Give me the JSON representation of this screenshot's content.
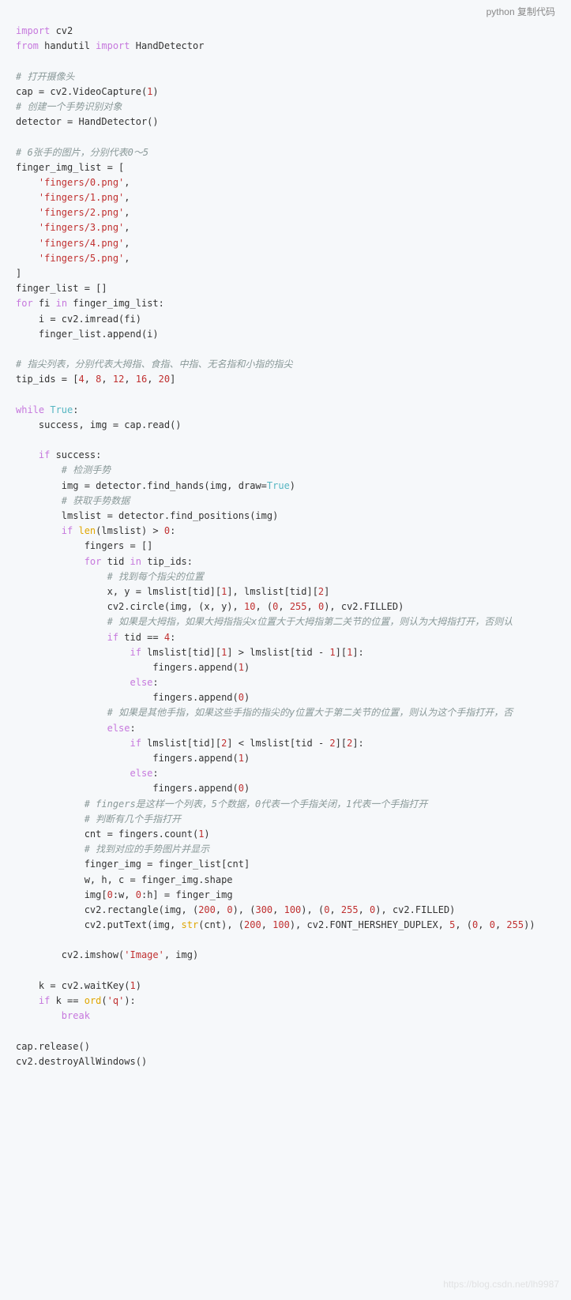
{
  "header": {
    "lang": "python",
    "copy": "复制代码"
  },
  "watermark": "https://blog.csdn.net/lh9987",
  "code_lines": [
    [
      {
        "t": "import",
        "c": "kw"
      },
      {
        "t": " cv2",
        "c": "id"
      }
    ],
    [
      {
        "t": "from",
        "c": "kw"
      },
      {
        "t": " handutil ",
        "c": "id"
      },
      {
        "t": "import",
        "c": "kw"
      },
      {
        "t": " HandDetector",
        "c": "id"
      }
    ],
    [],
    [
      {
        "t": "# 打开摄像头",
        "c": "com"
      }
    ],
    [
      {
        "t": "cap = cv2.VideoCapture(",
        "c": "id"
      },
      {
        "t": "1",
        "c": "num"
      },
      {
        "t": ")",
        "c": "id"
      }
    ],
    [
      {
        "t": "# 创建一个手势识别对象",
        "c": "com"
      }
    ],
    [
      {
        "t": "detector = HandDetector()",
        "c": "id"
      }
    ],
    [],
    [
      {
        "t": "# 6张手的图片，分别代表0～5",
        "c": "com"
      }
    ],
    [
      {
        "t": "finger_img_list = [",
        "c": "id"
      }
    ],
    [
      {
        "t": "    ",
        "c": "id"
      },
      {
        "t": "'fingers/0.png'",
        "c": "str"
      },
      {
        "t": ",",
        "c": "id"
      }
    ],
    [
      {
        "t": "    ",
        "c": "id"
      },
      {
        "t": "'fingers/1.png'",
        "c": "str"
      },
      {
        "t": ",",
        "c": "id"
      }
    ],
    [
      {
        "t": "    ",
        "c": "id"
      },
      {
        "t": "'fingers/2.png'",
        "c": "str"
      },
      {
        "t": ",",
        "c": "id"
      }
    ],
    [
      {
        "t": "    ",
        "c": "id"
      },
      {
        "t": "'fingers/3.png'",
        "c": "str"
      },
      {
        "t": ",",
        "c": "id"
      }
    ],
    [
      {
        "t": "    ",
        "c": "id"
      },
      {
        "t": "'fingers/4.png'",
        "c": "str"
      },
      {
        "t": ",",
        "c": "id"
      }
    ],
    [
      {
        "t": "    ",
        "c": "id"
      },
      {
        "t": "'fingers/5.png'",
        "c": "str"
      },
      {
        "t": ",",
        "c": "id"
      }
    ],
    [
      {
        "t": "]",
        "c": "id"
      }
    ],
    [
      {
        "t": "finger_list = []",
        "c": "id"
      }
    ],
    [
      {
        "t": "for",
        "c": "kw"
      },
      {
        "t": " fi ",
        "c": "id"
      },
      {
        "t": "in",
        "c": "kw"
      },
      {
        "t": " finger_img_list:",
        "c": "id"
      }
    ],
    [
      {
        "t": "    i = cv2.imread(fi)",
        "c": "id"
      }
    ],
    [
      {
        "t": "    finger_list.append(i)",
        "c": "id"
      }
    ],
    [],
    [
      {
        "t": "# 指尖列表，分别代表大拇指、食指、中指、无名指和小指的指尖",
        "c": "com"
      }
    ],
    [
      {
        "t": "tip_ids = [",
        "c": "id"
      },
      {
        "t": "4",
        "c": "num"
      },
      {
        "t": ", ",
        "c": "id"
      },
      {
        "t": "8",
        "c": "num"
      },
      {
        "t": ", ",
        "c": "id"
      },
      {
        "t": "12",
        "c": "num"
      },
      {
        "t": ", ",
        "c": "id"
      },
      {
        "t": "16",
        "c": "num"
      },
      {
        "t": ", ",
        "c": "id"
      },
      {
        "t": "20",
        "c": "num"
      },
      {
        "t": "]",
        "c": "id"
      }
    ],
    [],
    [
      {
        "t": "while",
        "c": "kw"
      },
      {
        "t": " ",
        "c": "id"
      },
      {
        "t": "True",
        "c": "bool"
      },
      {
        "t": ":",
        "c": "id"
      }
    ],
    [
      {
        "t": "    success, img = cap.read()",
        "c": "id"
      }
    ],
    [],
    [
      {
        "t": "    ",
        "c": "id"
      },
      {
        "t": "if",
        "c": "kw"
      },
      {
        "t": " success:",
        "c": "id"
      }
    ],
    [
      {
        "t": "        ",
        "c": "id"
      },
      {
        "t": "# 检测手势",
        "c": "com"
      }
    ],
    [
      {
        "t": "        img = detector.find_hands(img, draw=",
        "c": "id"
      },
      {
        "t": "True",
        "c": "bool"
      },
      {
        "t": ")",
        "c": "id"
      }
    ],
    [
      {
        "t": "        ",
        "c": "id"
      },
      {
        "t": "# 获取手势数据",
        "c": "com"
      }
    ],
    [
      {
        "t": "        lmslist = detector.find_positions(img)",
        "c": "id"
      }
    ],
    [
      {
        "t": "        ",
        "c": "id"
      },
      {
        "t": "if",
        "c": "kw"
      },
      {
        "t": " ",
        "c": "id"
      },
      {
        "t": "len",
        "c": "fn"
      },
      {
        "t": "(lmslist) > ",
        "c": "id"
      },
      {
        "t": "0",
        "c": "num"
      },
      {
        "t": ":",
        "c": "id"
      }
    ],
    [
      {
        "t": "            fingers = []",
        "c": "id"
      }
    ],
    [
      {
        "t": "            ",
        "c": "id"
      },
      {
        "t": "for",
        "c": "kw"
      },
      {
        "t": " tid ",
        "c": "id"
      },
      {
        "t": "in",
        "c": "kw"
      },
      {
        "t": " tip_ids:",
        "c": "id"
      }
    ],
    [
      {
        "t": "                ",
        "c": "id"
      },
      {
        "t": "# 找到每个指尖的位置",
        "c": "com"
      }
    ],
    [
      {
        "t": "                x, y = lmslist[tid][",
        "c": "id"
      },
      {
        "t": "1",
        "c": "num"
      },
      {
        "t": "], lmslist[tid][",
        "c": "id"
      },
      {
        "t": "2",
        "c": "num"
      },
      {
        "t": "]",
        "c": "id"
      }
    ],
    [
      {
        "t": "                cv2.circle(img, (x, y), ",
        "c": "id"
      },
      {
        "t": "10",
        "c": "num"
      },
      {
        "t": ", (",
        "c": "id"
      },
      {
        "t": "0",
        "c": "num"
      },
      {
        "t": ", ",
        "c": "id"
      },
      {
        "t": "255",
        "c": "num"
      },
      {
        "t": ", ",
        "c": "id"
      },
      {
        "t": "0",
        "c": "num"
      },
      {
        "t": "), cv2.FILLED)",
        "c": "id"
      }
    ],
    [
      {
        "t": "                ",
        "c": "id"
      },
      {
        "t": "# 如果是大拇指，如果大拇指指尖x位置大于大拇指第二关节的位置，则认为大拇指打开，否则认",
        "c": "com"
      }
    ],
    [
      {
        "t": "                ",
        "c": "id"
      },
      {
        "t": "if",
        "c": "kw"
      },
      {
        "t": " tid == ",
        "c": "id"
      },
      {
        "t": "4",
        "c": "num"
      },
      {
        "t": ":",
        "c": "id"
      }
    ],
    [
      {
        "t": "                    ",
        "c": "id"
      },
      {
        "t": "if",
        "c": "kw"
      },
      {
        "t": " lmslist[tid][",
        "c": "id"
      },
      {
        "t": "1",
        "c": "num"
      },
      {
        "t": "] > lmslist[tid - ",
        "c": "id"
      },
      {
        "t": "1",
        "c": "num"
      },
      {
        "t": "][",
        "c": "id"
      },
      {
        "t": "1",
        "c": "num"
      },
      {
        "t": "]:",
        "c": "id"
      }
    ],
    [
      {
        "t": "                        fingers.append(",
        "c": "id"
      },
      {
        "t": "1",
        "c": "num"
      },
      {
        "t": ")",
        "c": "id"
      }
    ],
    [
      {
        "t": "                    ",
        "c": "id"
      },
      {
        "t": "else",
        "c": "kw"
      },
      {
        "t": ":",
        "c": "id"
      }
    ],
    [
      {
        "t": "                        fingers.append(",
        "c": "id"
      },
      {
        "t": "0",
        "c": "num"
      },
      {
        "t": ")",
        "c": "id"
      }
    ],
    [
      {
        "t": "                ",
        "c": "id"
      },
      {
        "t": "# 如果是其他手指，如果这些手指的指尖的y位置大于第二关节的位置，则认为这个手指打开，否",
        "c": "com"
      }
    ],
    [
      {
        "t": "                ",
        "c": "id"
      },
      {
        "t": "else",
        "c": "kw"
      },
      {
        "t": ":",
        "c": "id"
      }
    ],
    [
      {
        "t": "                    ",
        "c": "id"
      },
      {
        "t": "if",
        "c": "kw"
      },
      {
        "t": " lmslist[tid][",
        "c": "id"
      },
      {
        "t": "2",
        "c": "num"
      },
      {
        "t": "] < lmslist[tid - ",
        "c": "id"
      },
      {
        "t": "2",
        "c": "num"
      },
      {
        "t": "][",
        "c": "id"
      },
      {
        "t": "2",
        "c": "num"
      },
      {
        "t": "]:",
        "c": "id"
      }
    ],
    [
      {
        "t": "                        fingers.append(",
        "c": "id"
      },
      {
        "t": "1",
        "c": "num"
      },
      {
        "t": ")",
        "c": "id"
      }
    ],
    [
      {
        "t": "                    ",
        "c": "id"
      },
      {
        "t": "else",
        "c": "kw"
      },
      {
        "t": ":",
        "c": "id"
      }
    ],
    [
      {
        "t": "                        fingers.append(",
        "c": "id"
      },
      {
        "t": "0",
        "c": "num"
      },
      {
        "t": ")",
        "c": "id"
      }
    ],
    [
      {
        "t": "            ",
        "c": "id"
      },
      {
        "t": "# fingers是这样一个列表，5个数据，0代表一个手指关闭，1代表一个手指打开",
        "c": "com"
      }
    ],
    [
      {
        "t": "            ",
        "c": "id"
      },
      {
        "t": "# 判断有几个手指打开",
        "c": "com"
      }
    ],
    [
      {
        "t": "            cnt = fingers.count(",
        "c": "id"
      },
      {
        "t": "1",
        "c": "num"
      },
      {
        "t": ")",
        "c": "id"
      }
    ],
    [
      {
        "t": "            ",
        "c": "id"
      },
      {
        "t": "# 找到对应的手势图片并显示",
        "c": "com"
      }
    ],
    [
      {
        "t": "            finger_img = finger_list[cnt]",
        "c": "id"
      }
    ],
    [
      {
        "t": "            w, h, c = finger_img.shape",
        "c": "id"
      }
    ],
    [
      {
        "t": "            img[",
        "c": "id"
      },
      {
        "t": "0",
        "c": "num"
      },
      {
        "t": ":w, ",
        "c": "id"
      },
      {
        "t": "0",
        "c": "num"
      },
      {
        "t": ":h] = finger_img",
        "c": "id"
      }
    ],
    [
      {
        "t": "            cv2.rectangle(img, (",
        "c": "id"
      },
      {
        "t": "200",
        "c": "num"
      },
      {
        "t": ", ",
        "c": "id"
      },
      {
        "t": "0",
        "c": "num"
      },
      {
        "t": "), (",
        "c": "id"
      },
      {
        "t": "300",
        "c": "num"
      },
      {
        "t": ", ",
        "c": "id"
      },
      {
        "t": "100",
        "c": "num"
      },
      {
        "t": "), (",
        "c": "id"
      },
      {
        "t": "0",
        "c": "num"
      },
      {
        "t": ", ",
        "c": "id"
      },
      {
        "t": "255",
        "c": "num"
      },
      {
        "t": ", ",
        "c": "id"
      },
      {
        "t": "0",
        "c": "num"
      },
      {
        "t": "), cv2.FILLED)",
        "c": "id"
      }
    ],
    [
      {
        "t": "            cv2.putText(img, ",
        "c": "id"
      },
      {
        "t": "str",
        "c": "fn"
      },
      {
        "t": "(cnt), (",
        "c": "id"
      },
      {
        "t": "200",
        "c": "num"
      },
      {
        "t": ", ",
        "c": "id"
      },
      {
        "t": "100",
        "c": "num"
      },
      {
        "t": "), cv2.FONT_HERSHEY_DUPLEX, ",
        "c": "id"
      },
      {
        "t": "5",
        "c": "num"
      },
      {
        "t": ", (",
        "c": "id"
      },
      {
        "t": "0",
        "c": "num"
      },
      {
        "t": ", ",
        "c": "id"
      },
      {
        "t": "0",
        "c": "num"
      },
      {
        "t": ", ",
        "c": "id"
      },
      {
        "t": "255",
        "c": "num"
      },
      {
        "t": "))",
        "c": "id"
      }
    ],
    [],
    [
      {
        "t": "        cv2.imshow(",
        "c": "id"
      },
      {
        "t": "'Image'",
        "c": "str"
      },
      {
        "t": ", img)",
        "c": "id"
      }
    ],
    [],
    [
      {
        "t": "    k = cv2.waitKey(",
        "c": "id"
      },
      {
        "t": "1",
        "c": "num"
      },
      {
        "t": ")",
        "c": "id"
      }
    ],
    [
      {
        "t": "    ",
        "c": "id"
      },
      {
        "t": "if",
        "c": "kw"
      },
      {
        "t": " k == ",
        "c": "id"
      },
      {
        "t": "ord",
        "c": "fn"
      },
      {
        "t": "(",
        "c": "id"
      },
      {
        "t": "'q'",
        "c": "str"
      },
      {
        "t": "):",
        "c": "id"
      }
    ],
    [
      {
        "t": "        ",
        "c": "id"
      },
      {
        "t": "break",
        "c": "kw"
      }
    ],
    [],
    [
      {
        "t": "cap.release()",
        "c": "id"
      }
    ],
    [
      {
        "t": "cv2.destroyAllWindows()",
        "c": "id"
      }
    ]
  ]
}
